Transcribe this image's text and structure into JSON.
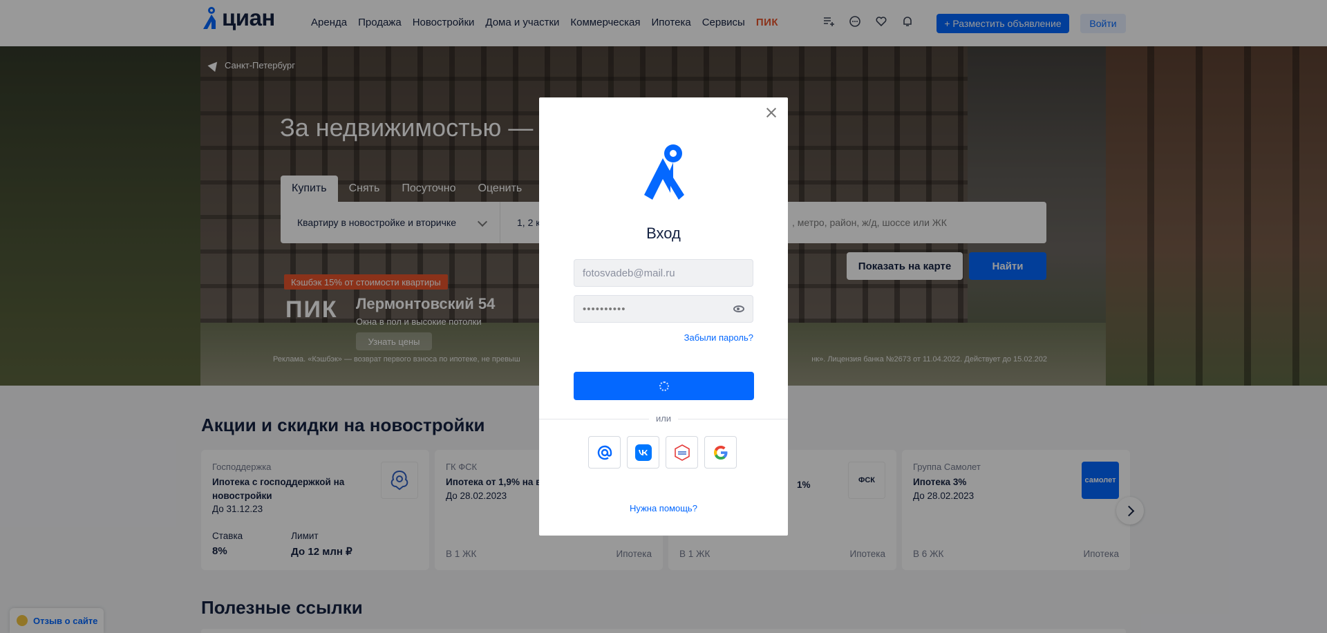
{
  "header": {
    "logo_text": "циан",
    "nav": [
      "Аренда",
      "Продажа",
      "Новостройки",
      "Дома и участки",
      "Коммерческая",
      "Ипотека",
      "Сервисы"
    ],
    "nav_brand": "ПИК",
    "icons": [
      "compare-list-icon",
      "chat-icon",
      "heart-icon",
      "bell-icon"
    ],
    "post_button": "+ Разместить объявление",
    "login_button": "Войти"
  },
  "hero": {
    "city": "Санкт-Петербург",
    "title": "За недвижимостью —",
    "tabs": [
      "Купить",
      "Снять",
      "Посуточно",
      "Оценить"
    ],
    "active_tab": "Купить",
    "search": {
      "type_value": "Квартиру в новостройке и вторичке",
      "rooms_value": "1, 2 к",
      "address_placeholder": ", метро, район, ж/д, шоссе или ЖК"
    },
    "map_button": "Показать на карте",
    "find_button": "Найти",
    "promo": {
      "tag": "Кэшбэк 15% от стоимости квартиры",
      "brand": "ПИК",
      "title": "Лермонтовский 54",
      "subtitle": "Окна в пол и высокие потолки",
      "button": "Узнать цены",
      "disclaimer_left": "Реклама. «Кэшбэк» — возврат первого взноса по ипотеке, не превыш",
      "disclaimer_right": "нк». Лицензия банка №2673 от 11.04.2022. Действует до 15.02.202"
    }
  },
  "promotions": {
    "title": "Акции и скидки на новостройки",
    "cards": [
      {
        "org": "Господдержка",
        "name": "Ипотека с господдержкой на новостройки",
        "date": "До 31.12.23",
        "stat1_label": "Ставка",
        "stat1_value": "8%",
        "stat2_label": "Лимит",
        "stat2_value": "До 12 млн ₽"
      },
      {
        "org": "ГК ФСК",
        "name": "Ипотека от 1,9% на вс",
        "date": "До 28.02.2023",
        "foot_left": "В 1 ЖК",
        "foot_right": "Ипотека"
      },
      {
        "name_tail": "1%",
        "logo": "ФСК",
        "foot_left": "В 1 ЖК",
        "foot_right": "Ипотека"
      },
      {
        "org": "Группа Самолет",
        "name": "Ипотека 3%",
        "date": "До 28.02.2023",
        "logo": "самолет",
        "foot_left": "В 6 ЖК",
        "foot_right": "Ипотека"
      }
    ]
  },
  "useful_links": {
    "title": "Полезные ссылки"
  },
  "feedback": {
    "label": "Отзыв о сайте"
  },
  "modal": {
    "title": "Вход",
    "email_value": "fotosvadeb@mail.ru",
    "password_mask": "••••••••••",
    "forgot": "Забыли пароль?",
    "or": "или",
    "social": [
      "mail-ru-icon",
      "vk-icon",
      "gosuslugi-icon",
      "google-icon"
    ],
    "help": "Нужна помощь?"
  },
  "colors": {
    "accent": "#0468ff",
    "brand_dark": "#152242",
    "pik": "#e8542c"
  }
}
